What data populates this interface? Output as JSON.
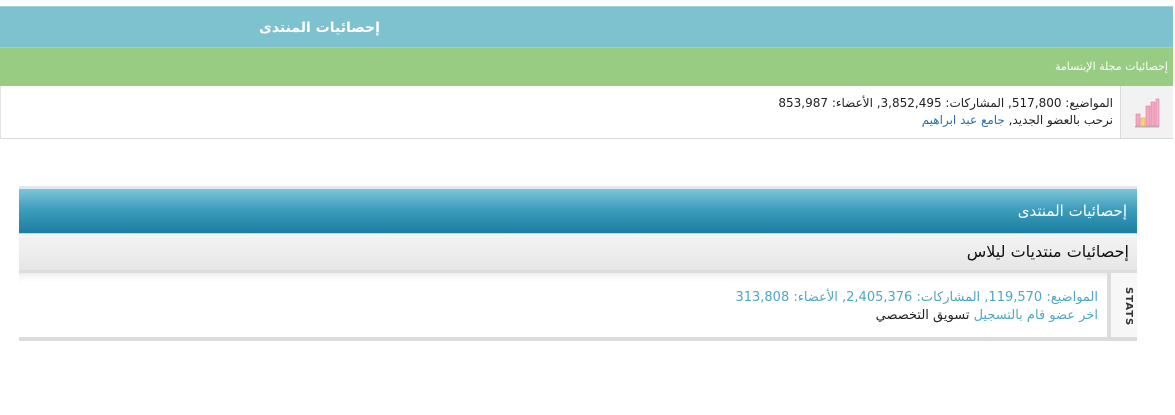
{
  "forum1": {
    "title": "إحصائيات المنتدى",
    "subtitle": "إحصائيات مجلة الإبتسامة",
    "stats_line": "المواضيع: 517,800, المشاركات: 3,852,495, الأعضاء: 853,987",
    "welcome_text": "نرحب بالعضو الجديد, ",
    "new_member": "جامع عبد ابراهيم",
    "icon": "bar-chart-icon"
  },
  "forum2": {
    "title": "إحصائيات المنتدى",
    "subtitle": "إحصائيات منتديات ليلاس",
    "side_label": "STATS",
    "stats_line": "المواضيع: 119,570, المشاركات: 2,405,376, الأعضاء: 313,808",
    "last_member_text": "اخر عضو قام بالتسجيل",
    "last_member": "تسويق التخصصي"
  },
  "colors": {
    "title_bar": "#7ec1cf",
    "green_bar": "#98cc82",
    "link": "#2b6ea8",
    "teal_text": "#4ea7c4"
  }
}
